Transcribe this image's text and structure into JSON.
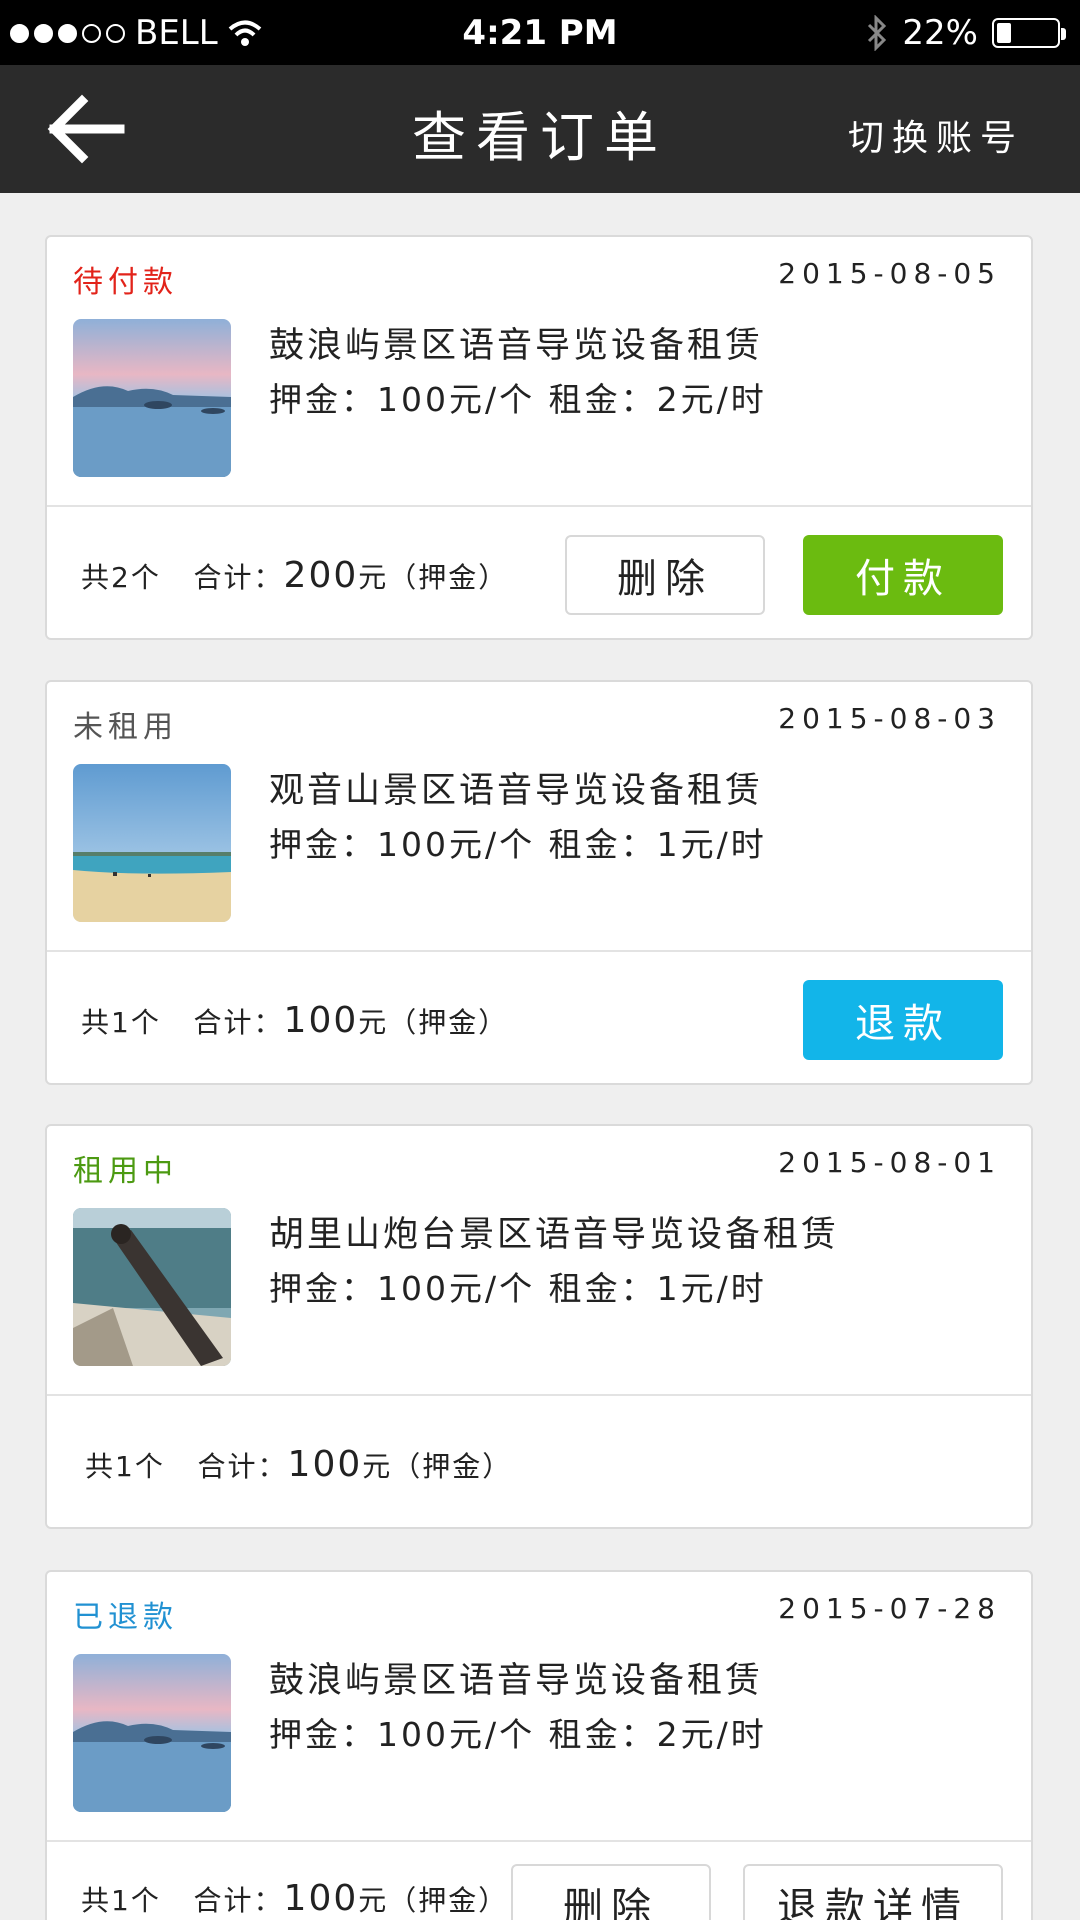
{
  "status_bar": {
    "carrier": "BELL",
    "time": "4:21 PM",
    "battery": "22%",
    "battery_level": 0.22,
    "signal_bars": 3
  },
  "nav": {
    "title": "查看订单",
    "switch_account": "切换账号"
  },
  "colors": {
    "pending": "#e2231a",
    "unused": "#555555",
    "renting": "#4c9a12",
    "refunded": "#2191d2",
    "pay": "#6bbb10",
    "refund": "#12b5e9"
  },
  "orders": [
    {
      "status": "待付款",
      "date": "2015-08-05",
      "title": "鼓浪屿景区语音导览设备租赁",
      "price": "押金：100元/个  租金：2元/时",
      "count": "共2个",
      "total_label": "合计：",
      "total": "200",
      "total_suffix": "元（押金）",
      "buttons": [
        "删除",
        "付款"
      ]
    },
    {
      "status": "未租用",
      "date": "2015-08-03",
      "title": "观音山景区语音导览设备租赁",
      "price": "押金：100元/个  租金：1元/时",
      "count": "共1个",
      "total_label": "合计：",
      "total": "100",
      "total_suffix": "元（押金）",
      "buttons": [
        "退款"
      ]
    },
    {
      "status": "租用中",
      "date": "2015-08-01",
      "title": "胡里山炮台景区语音导览设备租赁",
      "price": "押金：100元/个  租金：1元/时",
      "count": "共1个",
      "total_label": "合计：",
      "total": "100",
      "total_suffix": "元（押金）",
      "buttons": []
    },
    {
      "status": "已退款",
      "date": "2015-07-28",
      "title": "鼓浪屿景区语音导览设备租赁",
      "price": "押金：100元/个  租金：2元/时",
      "count": "共1个",
      "total_label": "合计：",
      "total": "100",
      "total_suffix": "元（押金）",
      "buttons": [
        "删除",
        "退款详情"
      ]
    }
  ]
}
